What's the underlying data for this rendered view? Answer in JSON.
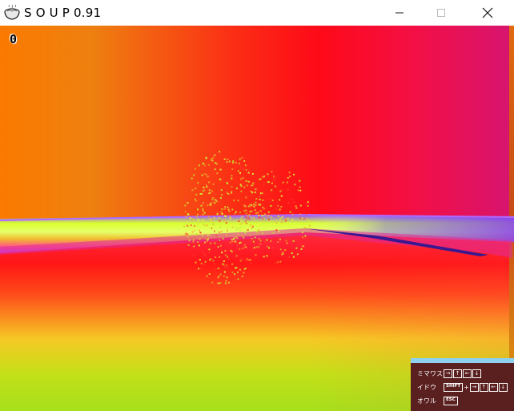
{
  "window": {
    "title": "S O U P 0.91",
    "icon": "soup-bowl-icon",
    "buttons": [
      "minimize",
      "maximize",
      "close"
    ]
  },
  "hud": {
    "score": "0"
  },
  "help": {
    "rows": [
      {
        "label": "ミマワス",
        "keys": [
          "→",
          "↑",
          "←",
          "↓"
        ]
      },
      {
        "label": "イドウ",
        "modifier": "SHIFT",
        "modifier_joiner": "+",
        "keys": [
          "→",
          "↑",
          "←",
          "↓"
        ]
      },
      {
        "label": "オワル",
        "keys": [
          "ESC"
        ]
      }
    ],
    "panel_color": "#5a1f1f",
    "accent_color": "#8fd0f0"
  },
  "scene": {
    "sky_colors": [
      "#fb7a00",
      "#fe0a18",
      "#d61470"
    ],
    "ground_colors": [
      "#ff1616",
      "#f6c824",
      "#a6e01c"
    ],
    "particle_colors": [
      "#c8e832",
      "#e0f040",
      "#ff3a2a",
      "#f0b030"
    ]
  }
}
